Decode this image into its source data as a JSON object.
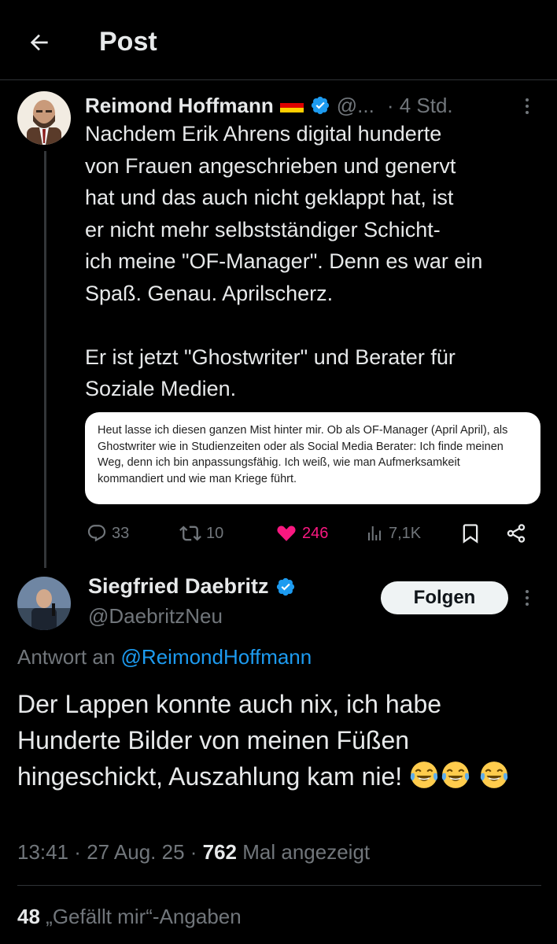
{
  "header": {
    "title": "Post"
  },
  "tweet": {
    "author_name": "Reimond Hoffmann",
    "handle_truncated": "@...",
    "time": "· 4 Std.",
    "text": "Nachdem Erik Ahrens digital hunderte\nvon Frauen angeschrieben und genervt\nhat und das auch nicht geklappt hat, ist\ner nicht mehr selbstständiger Schicht-\nich meine \"OF-Manager\". Denn es war ein\nSpaß. Genau. Aprilscherz.\n\nEr ist jetzt \"Ghostwriter\" und Berater für\nSoziale Medien.",
    "quoted_image_text": "Heut lasse ich diesen ganzen Mist hinter mir. Ob als OF-Manager (April April), als Ghostwriter wie in Studienzeiten oder als Social Media Berater: Ich finde meinen Weg, denn ich bin anpassungsfähig. Ich weiß, wie man Aufmerksamkeit kommandiert und wie man Kriege führt.",
    "replies": "33",
    "reposts": "10",
    "likes": "246",
    "views": "7,1K",
    "flag_colors": [
      "#000000",
      "#dd0000",
      "#ffce00"
    ]
  },
  "reply": {
    "author_name": "Siegfried Daebritz",
    "handle": "@DaebritzNeu",
    "follow_label": "Folgen",
    "reply_to_prefix": "Antwort an",
    "reply_to_handle": "@ReimondHoffmann",
    "text": "Der Lappen konnte auch nix, ich habe Hunderte Bilder von meinen Füßen hingeschickt, Auszahlung kam nie!",
    "emojis": [
      "face-with-tears-of-joy",
      "face-with-tears-of-joy",
      "face-with-tears-of-joy"
    ],
    "time": "13:41",
    "date": "27 Aug. 25",
    "views_count": "762",
    "views_label": "Mal angezeigt",
    "likes_count": "48",
    "likes_label": "„Gefällt mir“-Angaben"
  },
  "colors": {
    "accent": "#1d9bf0",
    "like": "#f91880",
    "muted": "#71767b",
    "background": "#000000"
  }
}
